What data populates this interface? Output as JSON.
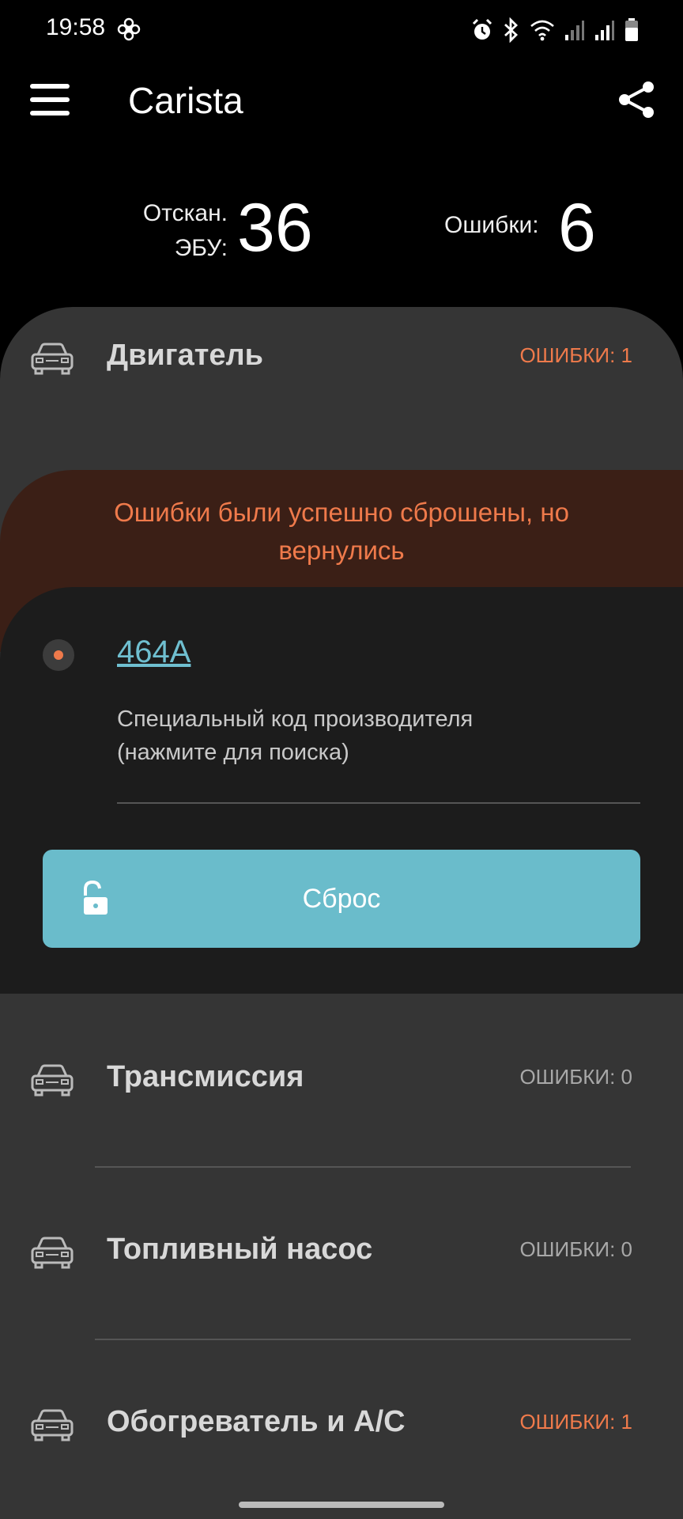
{
  "status_bar": {
    "time": "19:58",
    "icons": [
      "fan-icon",
      "alarm-icon",
      "bluetooth-icon",
      "wifi-icon",
      "signal-icon",
      "signal-icon",
      "battery-icon"
    ]
  },
  "app_bar": {
    "title": "Carista",
    "menu_icon": "menu-icon",
    "share_icon": "share-icon"
  },
  "stats": {
    "ecu_label_line1": "Отскан.",
    "ecu_label_line2": "ЭБУ:",
    "ecu_value": "36",
    "errors_label": "Ошибки:",
    "errors_value": "6"
  },
  "sections": [
    {
      "label": "Двигатель",
      "errors": "ОШИБКИ: 1",
      "alert": true
    },
    {
      "label": "Трансмиссия",
      "errors": "ОШИБКИ: 0",
      "alert": false
    },
    {
      "label": "Топливный насос",
      "errors": "ОШИБКИ: 0",
      "alert": false
    },
    {
      "label": "Обогреватель и A/C",
      "errors": "ОШИБКИ: 1",
      "alert": true
    }
  ],
  "warning": {
    "line1": "Ошибки были успешно сброшены, но",
    "line2": "вернулись"
  },
  "fault": {
    "code": "464A",
    "description_line1": "Специальный код производителя",
    "description_line2": "(нажмите для поиска)"
  },
  "reset_button": {
    "label": "Сброс",
    "icon": "unlock-icon"
  },
  "colors": {
    "accent": "#6abccb",
    "alert": "#ef7a4b",
    "sheet": "#353535",
    "panel": "#1c1c1c",
    "warning_band": "#3b1f16"
  }
}
